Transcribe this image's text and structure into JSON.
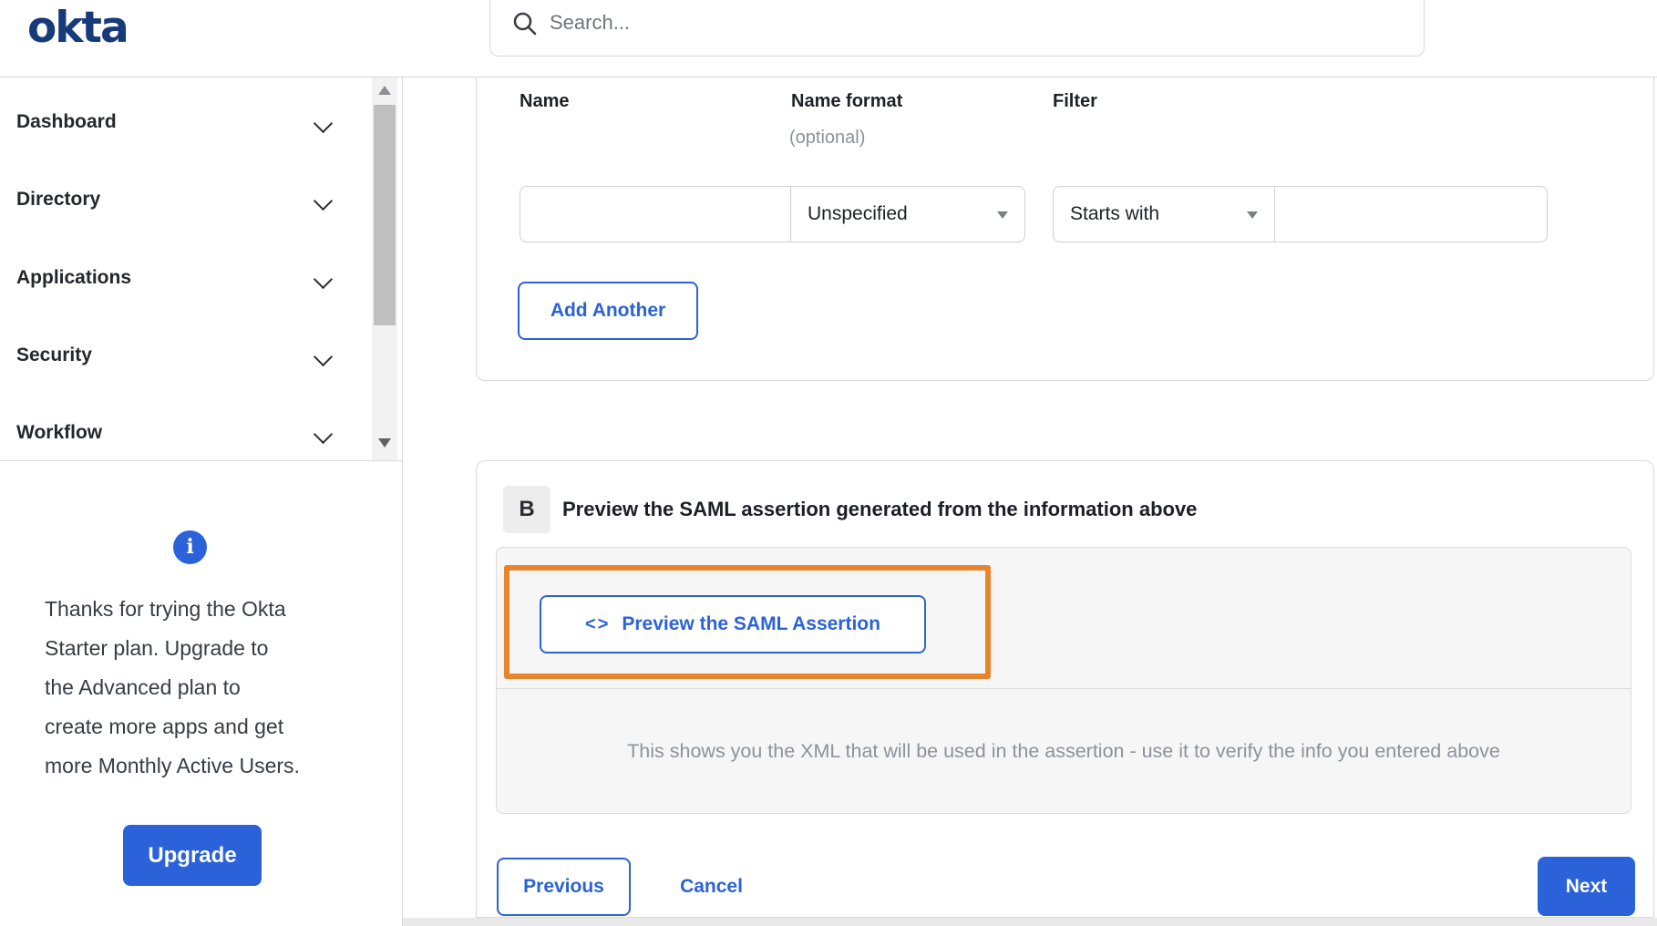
{
  "header": {
    "logo_text": "okta",
    "search_placeholder": "Search..."
  },
  "sidebar": {
    "items": [
      {
        "label": "Dashboard"
      },
      {
        "label": "Directory"
      },
      {
        "label": "Applications"
      },
      {
        "label": "Security"
      },
      {
        "label": "Workflow"
      }
    ],
    "trial_notice": {
      "lines": [
        "Thanks for trying the Okta",
        "Starter plan. Upgrade to",
        "the Advanced plan to",
        "create more apps and get",
        "more Monthly Active Users."
      ],
      "upgrade_label": "Upgrade"
    }
  },
  "attribute_statements": {
    "columns": {
      "name": "Name",
      "name_format": "Name format",
      "name_format_note": "(optional)",
      "filter": "Filter"
    },
    "fields": {
      "name_value": "",
      "name_format_selected": "Unspecified",
      "filter_type_selected": "Starts with",
      "filter_value": ""
    },
    "add_another_label": "Add Another"
  },
  "preview_section": {
    "step_badge": "B",
    "heading": "Preview the SAML assertion generated from the information above",
    "code_icon_glyph": "<>",
    "preview_button_label": "Preview the SAML Assertion",
    "helper_text": "This shows you the XML that will be used in the assertion - use it to verify the info you entered above"
  },
  "footer": {
    "previous_label": "Previous",
    "cancel_label": "Cancel",
    "next_label": "Next"
  },
  "colors": {
    "accent_blue": "#2b62d9",
    "annotation_orange": "#e8852c",
    "logo_navy": "#173a7a",
    "panel_gray": "#f6f6f6",
    "border_gray": "#d8d8d8"
  }
}
